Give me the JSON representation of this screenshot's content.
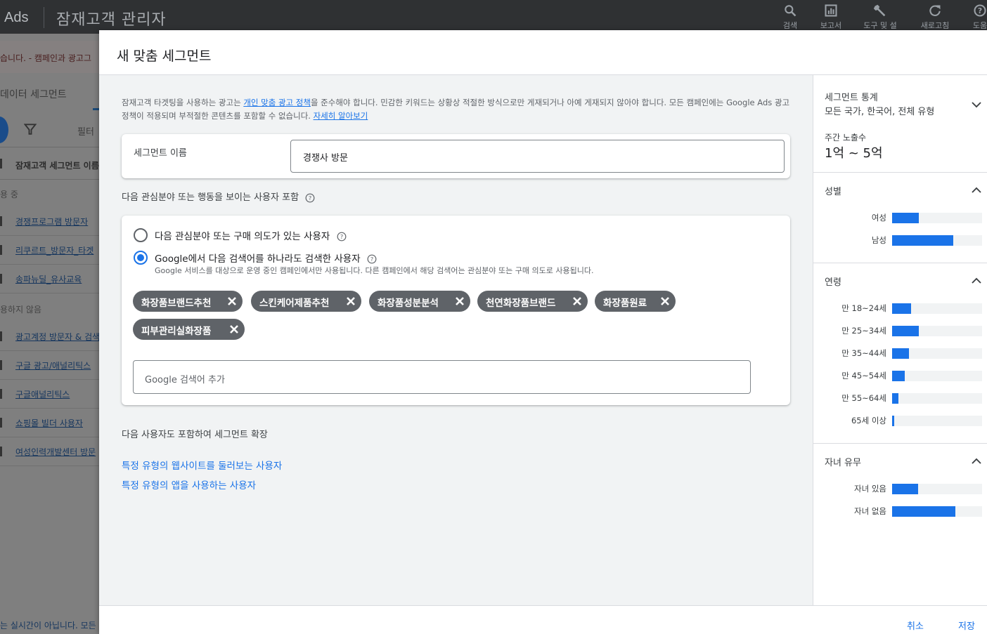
{
  "bg": {
    "logo": "Ads",
    "app_title": "잠재고객 관리자",
    "tools": [
      {
        "icon": "search-icon",
        "label": "검색"
      },
      {
        "icon": "report-icon",
        "label": "보고서"
      },
      {
        "icon": "wrench-icon",
        "label": "도구 및 설"
      },
      {
        "icon": "refresh-icon",
        "label": "새로고침"
      },
      {
        "icon": "help-icon",
        "label": "도움"
      }
    ],
    "notice": "습니다. - 캠페인과 광고그",
    "tab": "데이터 세그먼트",
    "filter_label": "필터",
    "column_header": "잠재고객 세그먼트 이름",
    "group_in_use": "용 중",
    "group_not_used": "용하지 않음",
    "rows_in_use": [
      "경쟁프로그램 방문자",
      "리쿠르트_방문자_타겟",
      "송파뉴딜_유사교육"
    ],
    "rows_not_used": [
      "광고계정 방문자 & 검색",
      "구글 광고/애널리틱스",
      "구글애널리틱스",
      "쇼핑몰 빌더 사용자",
      "여성인력개발센터 방문"
    ],
    "footer": "는 실시간이 아닙니다. 모든"
  },
  "modal": {
    "title": "새 맞춤 세그먼트",
    "policy_pre": "잠재고객 타겟팅을 사용하는 광고는 ",
    "policy_link": "개인 맞춤 광고 정책",
    "policy_mid": "을 준수해야 합니다. 민감한 키워드는 상황상 적절한 방식으로만 게재되거나 아예 게재되지 않아야 합니다. 모든 캠페인에는 Google Ads 광고 정책이 적용되며 부적절한 콘텐츠를 포함할 수 없습니다. ",
    "policy_learn": "자세히 알아보기",
    "segment_name_label": "세그먼트 이름",
    "segment_name_value": "경쟁사 방문",
    "include_label": "다음 관심분야 또는 행동을 보이는 사용자 포함",
    "option_interest": "다음 관심분야 또는 구매 의도가 있는 사용자",
    "option_search": "Google에서 다음 검색어를 하나라도 검색한 사용자",
    "option_search_desc": "Google 서비스를 대상으로 운영 중인 캠페인에서만 사용됩니다. 다른 캠페인에서 해당 검색어는 관심분야 또는 구매 의도로 사용됩니다.",
    "keywords": [
      "화장품브랜드추천",
      "스킨케어제품추천",
      "화장품성분분석",
      "천연화장품브랜드",
      "화장품원료",
      "피부관리실화장품"
    ],
    "keyword_placeholder": "Google 검색어 추가",
    "expand_label": "다음 사용자도 포함하여 세그먼트 확장",
    "expand_websites": "특정 유형의 웹사이트를 둘러보는 사용자",
    "expand_apps": "특정 유형의 앱을 사용하는 사용자",
    "cancel": "취소",
    "save": "저장"
  },
  "stats": {
    "title": "세그먼트 통계",
    "scope": "모든 국가, 한국어, 전체 유형",
    "weekly_label": "주간 노출수",
    "weekly_value": "1억 ~ 5억",
    "accent_color": "#1a73e8",
    "gender": {
      "title": "성별",
      "rows": [
        {
          "label": "여성",
          "value": 0.3
        },
        {
          "label": "남성",
          "value": 0.68
        }
      ]
    },
    "age": {
      "title": "연령",
      "rows": [
        {
          "label": "만 18~24세",
          "value": 0.21
        },
        {
          "label": "만 25~34세",
          "value": 0.3
        },
        {
          "label": "만 35~44세",
          "value": 0.19
        },
        {
          "label": "만 45~54세",
          "value": 0.14
        },
        {
          "label": "만 55~64세",
          "value": 0.07
        },
        {
          "label": "65세 이상",
          "value": 0.02
        }
      ]
    },
    "parental": {
      "title": "자녀 유무",
      "rows": [
        {
          "label": "자녀 있음",
          "value": 0.29
        },
        {
          "label": "자녀 없음",
          "value": 0.7
        }
      ]
    }
  }
}
